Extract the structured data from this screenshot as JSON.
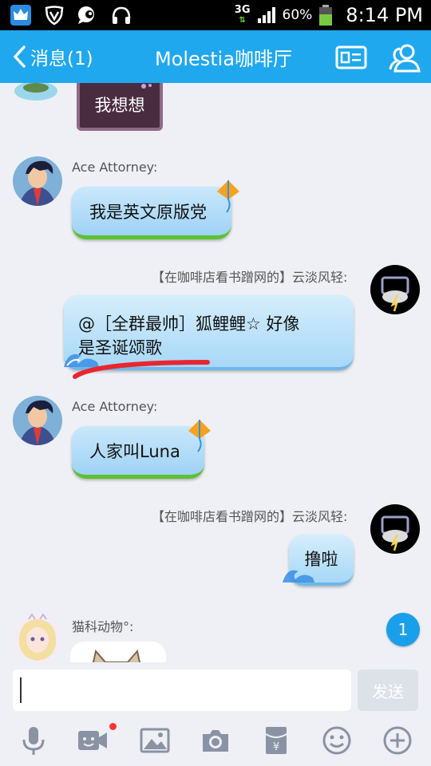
{
  "status_bar": {
    "network": "3G",
    "battery": "60%",
    "time": "8:14 PM"
  },
  "header": {
    "back_label": "消息(1)",
    "title": "Molestia咖啡厅"
  },
  "messages": [
    {
      "text": "我想想"
    },
    {
      "sender": "Ace Attorney:",
      "text": "我是英文原版党"
    },
    {
      "sender": "【在咖啡店看书蹭网的】云淡风轻:",
      "line1": "@［全群最帅］狐鲤鲤☆ 好像",
      "line2": "是圣诞颂歌"
    },
    {
      "sender": "Ace Attorney:",
      "text": "人家叫Luna"
    },
    {
      "sender": "【在咖啡店看书蹭网的】云淡风轻:",
      "text": "撸啦"
    },
    {
      "sender": "猫科动物°:"
    }
  ],
  "unread_count": "1",
  "input": {
    "value": "",
    "send_label": "发送"
  },
  "colors": {
    "header_bg": "#20a8ef",
    "chat_bg": "#eef0f5",
    "annotation_red": "#e8262f"
  }
}
